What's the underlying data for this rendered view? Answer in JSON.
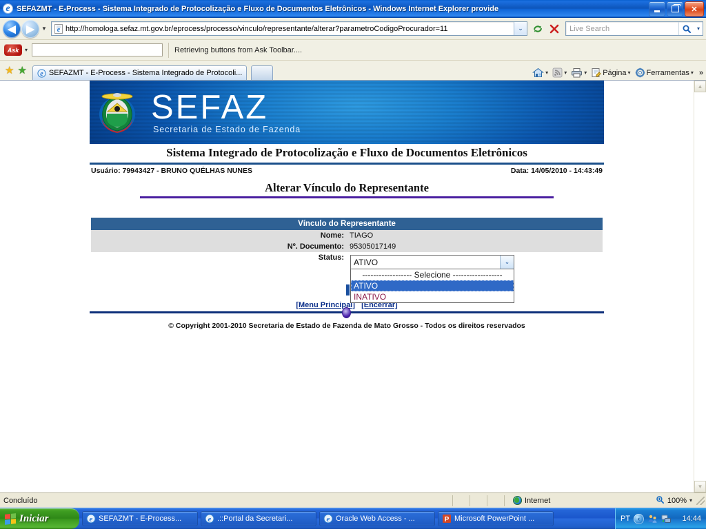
{
  "window": {
    "title": "SEFAZMT - E-Process - Sistema Integrado de Protocolização e Fluxo de Documentos Eletrônicos - Windows Internet Explorer provide",
    "app_icon": "internet-explorer-icon",
    "minimize_label": "",
    "restore_label": "",
    "close_label": "✕"
  },
  "address_bar": {
    "back_label": "◀",
    "forward_label": "▶",
    "history_dropdown_label": "▼",
    "url": "http://homologa.sefaz.mt.gov.br/eprocess/processo/vinculo/representante/alterar?parametroCodigoProcurador=11",
    "url_dropdown_label": "⌄",
    "refresh_label": "⟳",
    "stop_label": "✕",
    "search_placeholder": "Live Search",
    "search_value": "",
    "search_go_label": "⌕",
    "search_dropdown_label": "▾"
  },
  "ask_toolbar": {
    "logo_label": "Ask",
    "dropdown_label": "▾",
    "input_value": "",
    "status_text": "Retrieving buttons from Ask Toolbar...."
  },
  "tab_bar": {
    "favorites_star": "★",
    "add_favorites_star": "★",
    "tabs": [
      {
        "label": "SEFAZMT - E-Process - Sistema Integrado de Protocoli...",
        "active": true
      },
      {
        "label": "",
        "active": false
      }
    ],
    "right_buttons": [
      {
        "name": "home",
        "label": "",
        "caret": "▾"
      },
      {
        "name": "feeds",
        "label": "",
        "caret": "▾"
      },
      {
        "name": "print",
        "label": "",
        "caret": "▾"
      },
      {
        "name": "page",
        "label": "Página",
        "caret": "▾"
      },
      {
        "name": "tools",
        "label": "Ferramentas",
        "caret": "▾"
      }
    ],
    "overflow_label": "»"
  },
  "page": {
    "banner": {
      "logo_text": "SEFAZ",
      "logo_subtitle": "Secretaria de Estado de Fazenda",
      "coat_of_arms": "mato-grosso-coat-of-arms"
    },
    "system_title": "Sistema Integrado de Protocolização e Fluxo de Documentos Eletrônicos",
    "user_line": "Usuário: 79943427 - BRUNO QUÉLHAS NUNES",
    "date_line": "Data: 14/05/2010 - 14:43:49",
    "page_title": "Alterar Vínculo do Representante",
    "form": {
      "table_header": "Vínculo do Representante",
      "rows": [
        {
          "label": "Nome:",
          "value": "TIAGO"
        },
        {
          "label": "Nº. Documento:",
          "value": "95305017149"
        }
      ],
      "status_label": "Status:",
      "status_value": "ATIVO",
      "status_dropdown_arrow": "⌄",
      "status_options": [
        {
          "label": "------------------ Selecione ------------------",
          "selected": false
        },
        {
          "label": "ATIVO",
          "selected": true
        },
        {
          "label": "INATIVO",
          "selected": false
        }
      ]
    },
    "footer": {
      "links": [
        {
          "label": "[Menu Principal]"
        },
        {
          "label": "[Encerrar]"
        }
      ],
      "copyright": "© Copyright 2001-2010 Secretaria de Estado de Fazenda de Mato Grosso - Todos os direitos reservados"
    },
    "scrollbar": {
      "up_arrow": "▲",
      "down_arrow": "▼"
    }
  },
  "status_bar": {
    "text": "Concluído",
    "zone": "Internet",
    "zone_icon": "internet-globe-icon",
    "zoom": "100%",
    "zoom_dropdown": "▾"
  },
  "taskbar": {
    "start_label": "Iniciar",
    "items": [
      {
        "label": "SEFAZMT - E-Process...",
        "icon": "internet-explorer-icon",
        "active": true
      },
      {
        "label": ".::Portal da Secretari...",
        "icon": "internet-explorer-icon",
        "active": false
      },
      {
        "label": "Oracle Web Access - ...",
        "icon": "internet-explorer-icon",
        "active": false
      },
      {
        "label": "Microsoft PowerPoint ...",
        "icon": "powerpoint-icon",
        "active": false
      }
    ],
    "language": "PT",
    "tray_expand": "‹",
    "clock": "14:44"
  },
  "colors": {
    "title_blue": "#0d55bb",
    "table_header_blue": "#2f6194",
    "row_gray": "#dedede",
    "rule_purple": "#4a1fa0",
    "rule_navy": "#0d2f7a",
    "option_maroon": "#8b1a4a",
    "selection_blue": "#2f69c6",
    "banner_blue": "#1a7fd0"
  }
}
